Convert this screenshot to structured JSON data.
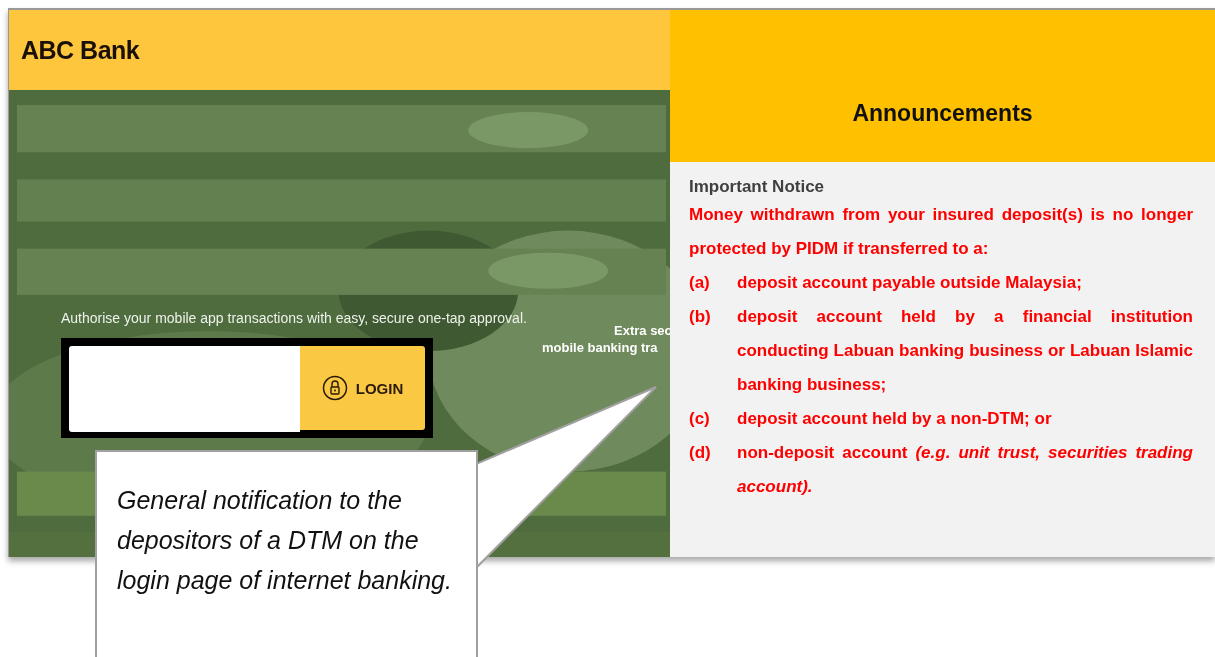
{
  "header": {
    "title": "ABC Bank"
  },
  "login_page": {
    "tagline": "Authorise your mobile app transactions with easy, secure one-tap approval.",
    "side_text": [
      "Extra sec",
      "mobile banking tra"
    ],
    "login_button": "LOGIN"
  },
  "announcements": {
    "title": "Announcements",
    "notice_heading": "Important Notice",
    "notice_intro": "Money withdrawn from your insured deposit(s) is no longer protected by PIDM if transferred to a:",
    "items": [
      {
        "marker": "(a)",
        "text": "deposit account payable outside Malaysia;"
      },
      {
        "marker": "(b)",
        "text": "deposit account held by a financial institution conducting Labuan banking business or Labuan Islamic banking business;"
      },
      {
        "marker": "(c)",
        "text": "deposit account held by a non-DTM; or"
      },
      {
        "marker": "(d)",
        "text": "non-deposit account *(e.g. unit trust, securities trading account).*"
      }
    ]
  },
  "callout": {
    "text": "General notification to the depositors of a DTM on the login page of internet banking."
  }
}
